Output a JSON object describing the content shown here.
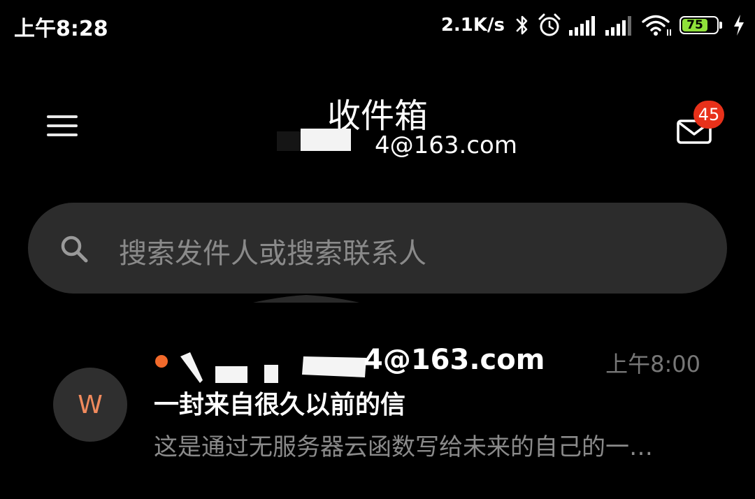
{
  "status_bar": {
    "time": "上午8:28",
    "network_speed": "2.1K/s",
    "battery_level": "75",
    "battery_color": "#8fe03a",
    "icons": [
      "bluetooth-icon",
      "alarm-icon",
      "signal-icon",
      "signal-icon",
      "wifi-icon",
      "battery-icon",
      "charging-icon"
    ]
  },
  "header": {
    "title": "收件箱",
    "account_email_visible": "4@163.com",
    "unread_count": "45",
    "menu_icon": "hamburger-menu-icon",
    "mailbox_icon": "envelope-icon"
  },
  "search": {
    "placeholder": "搜索发件人或搜索联系人"
  },
  "messages": [
    {
      "avatar_letter": "W",
      "sender_visible": "4@163.com",
      "time": "上午8:00",
      "subject": "一封来自很久以前的信",
      "preview": "这是通过无服务器云函数写给未来的自己的一…",
      "unread": true
    }
  ],
  "colors": {
    "background": "#000000",
    "search_bar": "#2c2c2c",
    "badge": "#e8311a",
    "unread_dot": "#f26a2b",
    "avatar_letter": "#f08a5d"
  }
}
